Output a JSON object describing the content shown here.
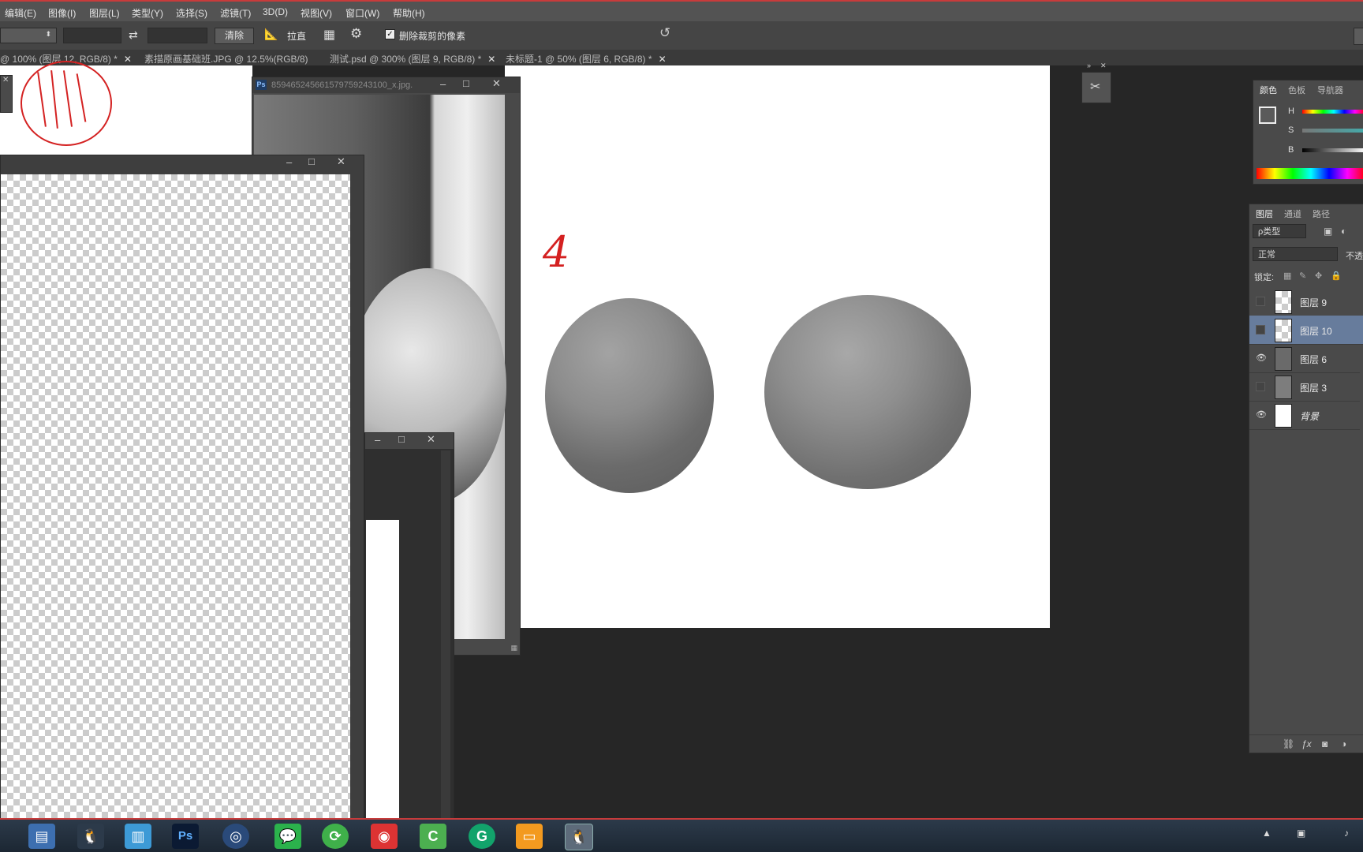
{
  "menu": [
    "编辑(E)",
    "图像(I)",
    "图层(L)",
    "类型(Y)",
    "选择(S)",
    "滤镜(T)",
    "3D(D)",
    "视图(V)",
    "窗口(W)",
    "帮助(H)"
  ],
  "options": {
    "straighten_label": "拉直",
    "clear_button": "清除",
    "delete_cropped_label": "删除裁剪的像素",
    "delete_cropped_checked": true
  },
  "tabs": [
    {
      "label": "@ 100% (图层 12, RGB/8) *"
    },
    {
      "label": "素描原画基础班.JPG @ 12.5%(RGB/8)"
    },
    {
      "label": "测试.psd @ 300% (图层 9, RGB/8) *"
    },
    {
      "label": "未标题-1 @ 50% (图层 6, RGB/8) *"
    }
  ],
  "floating_window": {
    "title": "8594652456615797592431​00_x.jpg..."
  },
  "canvas_annotation": "4",
  "color_panel": {
    "tabs": [
      "颜色",
      "色板",
      "导航器"
    ],
    "active_tab": "颜色",
    "sliders": [
      "H",
      "S",
      "B"
    ]
  },
  "layers_panel": {
    "tabs": [
      "图层",
      "通道",
      "路径"
    ],
    "active_tab": "图层",
    "filter_label": "ρ类型",
    "blend_mode": "正常",
    "opacity_label": "不透",
    "lock_label": "锁定:",
    "layers": [
      {
        "name": "图层 9",
        "visible": false,
        "selected": false
      },
      {
        "name": "图层 10",
        "visible": false,
        "selected": true
      },
      {
        "name": "图层 6",
        "visible": true,
        "selected": false
      },
      {
        "name": "图层 3",
        "visible": false,
        "selected": false
      },
      {
        "name": "背景",
        "visible": true,
        "selected": false
      }
    ]
  },
  "taskbar": {
    "apps": [
      "file-explorer",
      "qq",
      "notepad",
      "photoshop",
      "browser",
      "wechat",
      "app-green",
      "netease-music",
      "app-c",
      "app-g",
      "briefcase",
      "qq-active"
    ],
    "ps_label": "Ps"
  },
  "colors": {
    "menu_bg": "#535353",
    "options_bg": "#454545",
    "workspace_bg": "#262626",
    "panel_bg": "#4a4a4a",
    "selected_layer": "#677c9c",
    "accent_red": "#c83b3b"
  }
}
